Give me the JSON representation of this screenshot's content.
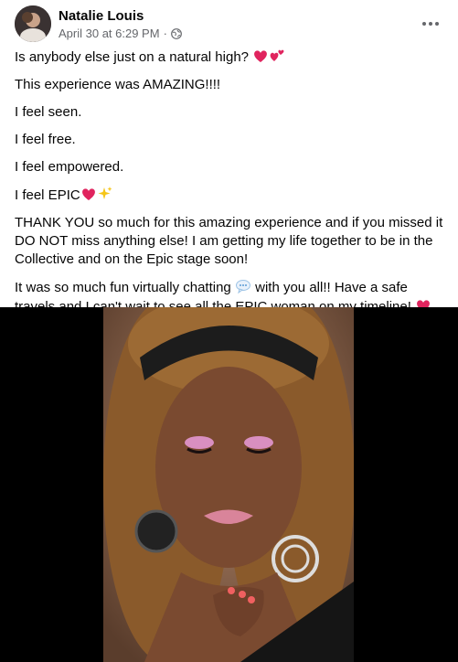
{
  "author": {
    "name": "Natalie Louis"
  },
  "post": {
    "timestamp": "April 30 at 6:29 PM",
    "separator": "·",
    "privacy_icon": "globe-icon",
    "more_icon": "more-options-icon",
    "paragraphs": {
      "p1": "Is anybody else just on a natural high?",
      "p2": "This experience was AMAZING!!!!",
      "p3": "I feel seen.",
      "p4": "I feel free.",
      "p5": "I feel empowered.",
      "p6": "I feel EPIC",
      "p7": "THANK YOU so much for this amazing experience and if you missed it DO NOT miss anything else! I am getting my life together to be in the Collective and on the Epic stage soon!",
      "p8a": "It was so much fun virtually chatting",
      "p8b": " with you all!! Have a safe travels and I can't wait to see all the EPIC woman on my timeline!"
    },
    "emojis": [
      "heart-exclamation",
      "two-hearts",
      "sparkles",
      "speech-balloon"
    ]
  },
  "colors": {
    "text": "#050505",
    "meta": "#65676b",
    "heart": "#e0245e",
    "media_bg": "#000000"
  }
}
